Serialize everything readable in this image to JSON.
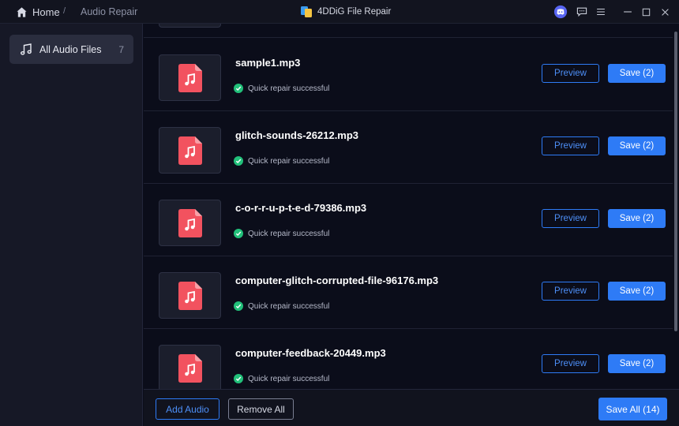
{
  "titlebar": {
    "home_label": "Home",
    "separator": "/",
    "current": "Audio Repair",
    "app_title": "4DDiG File Repair",
    "icons": [
      "discord-icon",
      "feedback-icon",
      "menu-icon",
      "minimize-icon",
      "maximize-icon",
      "close-icon"
    ]
  },
  "sidebar": {
    "items": [
      {
        "label": "All Audio Files",
        "count": "7",
        "icon": "music-note-icon"
      }
    ]
  },
  "files": [
    {
      "name": "sample1.mp3",
      "status": "Quick repair successful",
      "preview_label": "Preview",
      "save_label": "Save (2)"
    },
    {
      "name": "glitch-sounds-26212.mp3",
      "status": "Quick repair successful",
      "preview_label": "Preview",
      "save_label": "Save (2)"
    },
    {
      "name": "c-o-r-r-u-p-t-e-d-79386.mp3",
      "status": "Quick repair successful",
      "preview_label": "Preview",
      "save_label": "Save (2)"
    },
    {
      "name": "computer-glitch-corrupted-file-96176.mp3",
      "status": "Quick repair successful",
      "preview_label": "Preview",
      "save_label": "Save (2)"
    },
    {
      "name": "computer-feedback-20449.mp3",
      "status": "Quick repair successful",
      "preview_label": "Preview",
      "save_label": "Save (2)"
    }
  ],
  "bottombar": {
    "add_label": "Add Audio",
    "remove_label": "Remove All",
    "save_all_label": "Save All (14)"
  },
  "colors": {
    "accent": "#2e7bf6",
    "success": "#22c07a",
    "file_icon": "#f2525f",
    "background": "#0b0d1a"
  }
}
